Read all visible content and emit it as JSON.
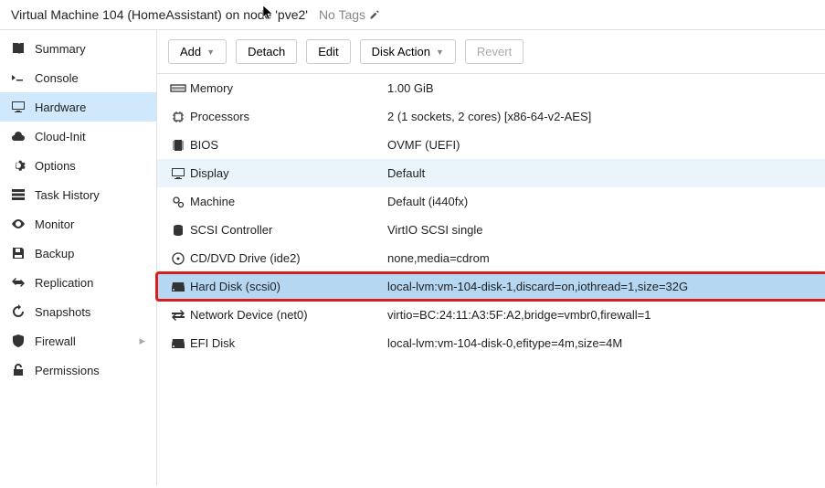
{
  "header": {
    "title": "Virtual Machine 104 (HomeAssistant) on node 'pve2'",
    "no_tags": "No Tags"
  },
  "sidebar": {
    "items": [
      {
        "label": "Summary"
      },
      {
        "label": "Console"
      },
      {
        "label": "Hardware"
      },
      {
        "label": "Cloud-Init"
      },
      {
        "label": "Options"
      },
      {
        "label": "Task History"
      },
      {
        "label": "Monitor"
      },
      {
        "label": "Backup"
      },
      {
        "label": "Replication"
      },
      {
        "label": "Snapshots"
      },
      {
        "label": "Firewall"
      },
      {
        "label": "Permissions"
      }
    ]
  },
  "toolbar": {
    "add": "Add",
    "detach": "Detach",
    "edit": "Edit",
    "disk_action": "Disk Action",
    "revert": "Revert"
  },
  "hardware": {
    "rows": [
      {
        "label": "Memory",
        "value": "1.00 GiB"
      },
      {
        "label": "Processors",
        "value": "2 (1 sockets, 2 cores) [x86-64-v2-AES]"
      },
      {
        "label": "BIOS",
        "value": "OVMF (UEFI)"
      },
      {
        "label": "Display",
        "value": "Default"
      },
      {
        "label": "Machine",
        "value": "Default (i440fx)"
      },
      {
        "label": "SCSI Controller",
        "value": "VirtIO SCSI single"
      },
      {
        "label": "CD/DVD Drive (ide2)",
        "value": "none,media=cdrom"
      },
      {
        "label": "Hard Disk (scsi0)",
        "value": "local-lvm:vm-104-disk-1,discard=on,iothread=1,size=32G"
      },
      {
        "label": "Network Device (net0)",
        "value": "virtio=BC:24:11:A3:5F:A2,bridge=vmbr0,firewall=1"
      },
      {
        "label": "EFI Disk",
        "value": "local-lvm:vm-104-disk-0,efitype=4m,size=4M"
      }
    ]
  }
}
